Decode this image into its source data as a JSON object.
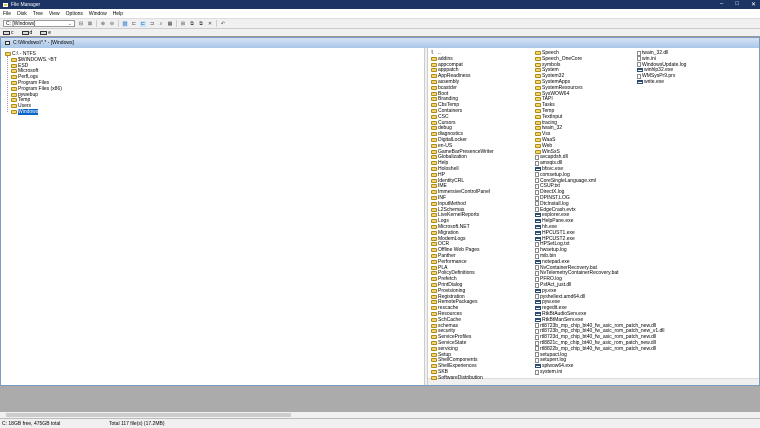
{
  "window": {
    "title": "File Manager",
    "controls": [
      "–",
      "□",
      "✕"
    ]
  },
  "menu": [
    "File",
    "Disk",
    "Tree",
    "View",
    "Options",
    "Window",
    "Help"
  ],
  "toolbar": {
    "drive_combo": "C: [Windows]",
    "icons": [
      "connect-drive-icon",
      "disconnect-drive-icon",
      "share-icon",
      "stop-share-icon",
      "tree-dir-view-icon",
      "tree-only-icon",
      "dir-only-icon",
      "expand-icon",
      "search-icon",
      "properties-icon",
      "new-window-icon",
      "copy-icon",
      "move-icon",
      "delete-icon",
      "undo-icon"
    ]
  },
  "drives": [
    "c",
    "d",
    "e"
  ],
  "child": {
    "title": "C:\\Windows\\*.* - [Windows]"
  },
  "tree": {
    "root": "C:\\ - NTFS",
    "items": [
      "$WINDOWS.~BT",
      "ESD",
      "Microsoft",
      "PerfLogs",
      "Program Files",
      "Program Files (x86)",
      "pywebup",
      "Temp",
      "Users",
      "Windows"
    ],
    "selected": "Windows"
  },
  "files": {
    "columns": [
      [
        [
          "..",
          "u"
        ],
        [
          "addins",
          "d"
        ],
        [
          "appcompat",
          "d"
        ],
        [
          "apppatch",
          "d"
        ],
        [
          "AppReadiness",
          "d"
        ],
        [
          "assembly",
          "d"
        ],
        [
          "bcastdvr",
          "d"
        ],
        [
          "Boot",
          "d"
        ],
        [
          "Branding",
          "d"
        ],
        [
          "CbsTemp",
          "d"
        ],
        [
          "Containers",
          "d"
        ],
        [
          "CSC",
          "d"
        ],
        [
          "Cursors",
          "d"
        ],
        [
          "debug",
          "d"
        ],
        [
          "diagnostics",
          "d"
        ],
        [
          "DigitalLocker",
          "d"
        ],
        [
          "en-US",
          "d"
        ],
        [
          "GameBarPresenceWriter",
          "d"
        ],
        [
          "Globalization",
          "d"
        ],
        [
          "Help",
          "d"
        ],
        [
          "Holoshell",
          "d"
        ],
        [
          "HP",
          "d"
        ],
        [
          "IdentityCRL",
          "d"
        ],
        [
          "IME",
          "d"
        ],
        [
          "ImmersiveControlPanel",
          "d"
        ],
        [
          "INF",
          "d"
        ],
        [
          "InputMethod",
          "d"
        ],
        [
          "L2Schemas",
          "d"
        ],
        [
          "LiveKernelReports",
          "d"
        ],
        [
          "Logs",
          "d"
        ],
        [
          "Microsoft.NET",
          "d"
        ],
        [
          "Migration",
          "d"
        ],
        [
          "ModemLogs",
          "d"
        ],
        [
          "OCR",
          "d"
        ],
        [
          "Offline Web Pages",
          "d"
        ],
        [
          "Panther",
          "d"
        ],
        [
          "Performance",
          "d"
        ],
        [
          "PLA",
          "d"
        ],
        [
          "PolicyDefinitions",
          "d"
        ],
        [
          "Prefetch",
          "d"
        ],
        [
          "PrintDialog",
          "d"
        ],
        [
          "Provisioning",
          "d"
        ],
        [
          "Registration",
          "d"
        ],
        [
          "RemotePackages",
          "d"
        ],
        [
          "rescache",
          "d"
        ],
        [
          "Resources",
          "d"
        ],
        [
          "SchCache",
          "d"
        ],
        [
          "schemas",
          "d"
        ],
        [
          "security",
          "d"
        ],
        [
          "ServiceProfiles",
          "d"
        ],
        [
          "ServiceState",
          "d"
        ],
        [
          "servicing",
          "d"
        ],
        [
          "Setup",
          "d"
        ],
        [
          "ShellComponents",
          "d"
        ],
        [
          "ShellExperiences",
          "d"
        ],
        [
          "SKB",
          "d"
        ],
        [
          "SoftwareDistribution",
          "d"
        ]
      ],
      [
        [
          "Speech",
          "d"
        ],
        [
          "Speech_OneCore",
          "d"
        ],
        [
          "symbols",
          "d"
        ],
        [
          "System",
          "d"
        ],
        [
          "System32",
          "d"
        ],
        [
          "SystemApps",
          "d"
        ],
        [
          "SystemResources",
          "d"
        ],
        [
          "SysWOW64",
          "d"
        ],
        [
          "TAPI",
          "d"
        ],
        [
          "Tasks",
          "d"
        ],
        [
          "Temp",
          "d"
        ],
        [
          "TextInput",
          "d"
        ],
        [
          "tracing",
          "d"
        ],
        [
          "twain_32",
          "d"
        ],
        [
          "Vss",
          "d"
        ],
        [
          "WaaS",
          "d"
        ],
        [
          "Web",
          "d"
        ],
        [
          "WinSxS",
          "d"
        ],
        [
          "avcapdsh.dll",
          "f"
        ],
        [
          "amsqis.dll",
          "f"
        ],
        [
          "bfsvc.exe",
          "x"
        ],
        [
          "comsetup.log",
          "f"
        ],
        [
          "CoreSingleLanguage.xml",
          "f"
        ],
        [
          "CSUP.txt",
          "f"
        ],
        [
          "DirectX.log",
          "f"
        ],
        [
          "DPINST.LOG",
          "f"
        ],
        [
          "DtcInstall.log",
          "f"
        ],
        [
          "EdgeCrash.evtx",
          "f"
        ],
        [
          "explorer.exe",
          "x"
        ],
        [
          "HelpPane.exe",
          "x"
        ],
        [
          "hh.exe",
          "x"
        ],
        [
          "HPCUST1.exe",
          "x"
        ],
        [
          "HPCUST2.exe",
          "x"
        ],
        [
          "HPSetLog.txt",
          "f"
        ],
        [
          "hwsetup.log",
          "f"
        ],
        [
          "mib.bin",
          "f"
        ],
        [
          "notepad.exe",
          "x"
        ],
        [
          "NvContainerRecovery.bat",
          "f"
        ],
        [
          "NvTelemetryContainerRecovery.bat",
          "f"
        ],
        [
          "PFRO.log",
          "f"
        ],
        [
          "PsfAct_just.dll",
          "f"
        ],
        [
          "py.exe",
          "x"
        ],
        [
          "pyshellext.amd64.dll",
          "f"
        ],
        [
          "pyw.exe",
          "x"
        ],
        [
          "regedit.exe",
          "x"
        ],
        [
          "RtkBtAudioServ.exe",
          "x"
        ],
        [
          "RtkBtManServ.exe",
          "x"
        ],
        [
          "rtl8723b_mp_chip_bt40_fw_asic_rom_patch_new.dll",
          "f"
        ],
        [
          "rtl8723b_mp_chip_bt40_fw_asic_rom_patch_new_v1.dll",
          "f"
        ],
        [
          "rtl8723d_mp_chip_bt40_fw_asic_rom_patch_new.dll",
          "f"
        ],
        [
          "rtl8821c_mp_chip_bt40_fw_asic_rom_patch_new.dll",
          "f"
        ],
        [
          "rtl8822b_mp_chip_bt40_fw_asic_rom_patch_new.dll",
          "f"
        ],
        [
          "setupact.log",
          "f"
        ],
        [
          "setuperr.log",
          "f"
        ],
        [
          "splwow64.exe",
          "x"
        ],
        [
          "system.ini",
          "f"
        ]
      ],
      [
        [
          "twain_32.dll",
          "f"
        ],
        [
          "win.ini",
          "f"
        ],
        [
          "WindowsUpdate.log",
          "f"
        ],
        [
          "winhlp32.exe",
          "x"
        ],
        [
          "WMSysPr9.prx",
          "f"
        ],
        [
          "write.exe",
          "x"
        ]
      ]
    ]
  },
  "status": {
    "left": "C: 18GB free,  475GB total",
    "right": "Total 117 file(s) (17.2MB)"
  }
}
